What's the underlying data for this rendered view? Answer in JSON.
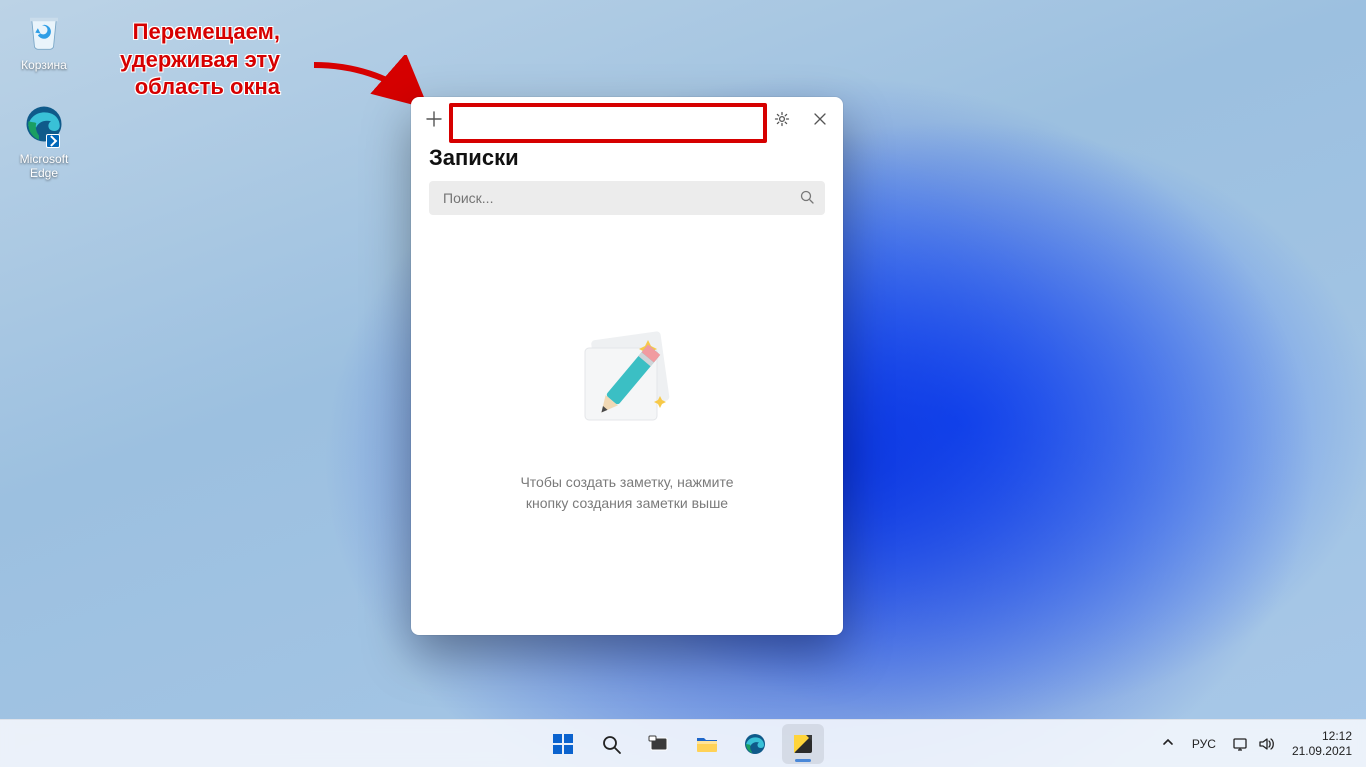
{
  "desktop": {
    "icons": {
      "recycle_bin": "Корзина",
      "edge": "Microsoft Edge"
    }
  },
  "annotation": {
    "line1": "Перемещаем,",
    "line2": "удерживая эту",
    "line3": "область окна"
  },
  "sticky_notes": {
    "title": "Записки",
    "search_placeholder": "Поиск...",
    "empty_line1": "Чтобы создать заметку, нажмите",
    "empty_line2": "кнопку создания заметки выше"
  },
  "tray": {
    "lang": "РУС",
    "time": "12:12",
    "date": "21.09.2021"
  }
}
